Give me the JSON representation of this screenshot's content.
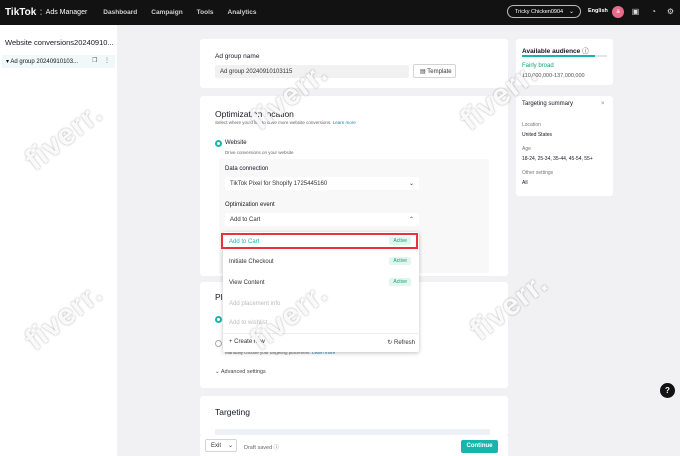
{
  "topbar": {
    "logo": "TikTok",
    "product": "Ads Manager",
    "nav": [
      "Dashboard",
      "Campaign",
      "Tools",
      "Analytics"
    ],
    "account": "Tricky Chicken0904",
    "language": "English",
    "avatar_initial": "a"
  },
  "sidebar": {
    "campaign_title": "Website conversions20240910...",
    "adgroup_label": "Ad group 20240910103..."
  },
  "adgroup_name": {
    "label": "Ad group name",
    "value": "Ad group 20240910103115",
    "template_button": "Template"
  },
  "optimization": {
    "title": "Optimization location",
    "subtitle": "Select where you'd like to drive more website conversions.",
    "learn_more": "Learn more",
    "website_label": "Website",
    "website_desc": "Drive conversions on your website",
    "data_connection_label": "Data connection",
    "data_connection_value": "TikTok Pixel for Shopify 1725445160",
    "event_label": "Optimization event",
    "event_value": "Add to Cart"
  },
  "dropdown": {
    "options": [
      {
        "label": "Add to Cart",
        "status": "Active"
      },
      {
        "label": "Initiate Checkout",
        "status": "Active"
      },
      {
        "label": "View Content",
        "status": "Active"
      }
    ],
    "add_placeholder": "Add placement info",
    "add_secondary": "Add to wishlist",
    "create_new": "Create new",
    "refresh": "Refresh"
  },
  "placement": {
    "title_partial": "Pla",
    "manual_desc": "Manually choose your targeting placement.",
    "learn_more": "Learn more",
    "advanced": "Advanced settings"
  },
  "targeting": {
    "title": "Targeting"
  },
  "footer": {
    "exit": "Exit",
    "draft": "Draft saved",
    "continue": "Continue"
  },
  "audience": {
    "title": "Available audience",
    "status": "Fairly broad",
    "range": "110,000,000-137,000,000"
  },
  "summary": {
    "title": "Targeting summary",
    "location_label": "Location",
    "location_value": "United States",
    "age_label": "Age",
    "age_value": "18-24, 25-34, 35-44, 45-54, 55+",
    "other_label": "Other settings",
    "other_value": "All"
  },
  "watermark": "fiverr.",
  "colors": {
    "accent": "#19b5ad",
    "topbar": "#121212",
    "active": "#14a36e",
    "highlight": "#e8323c"
  }
}
